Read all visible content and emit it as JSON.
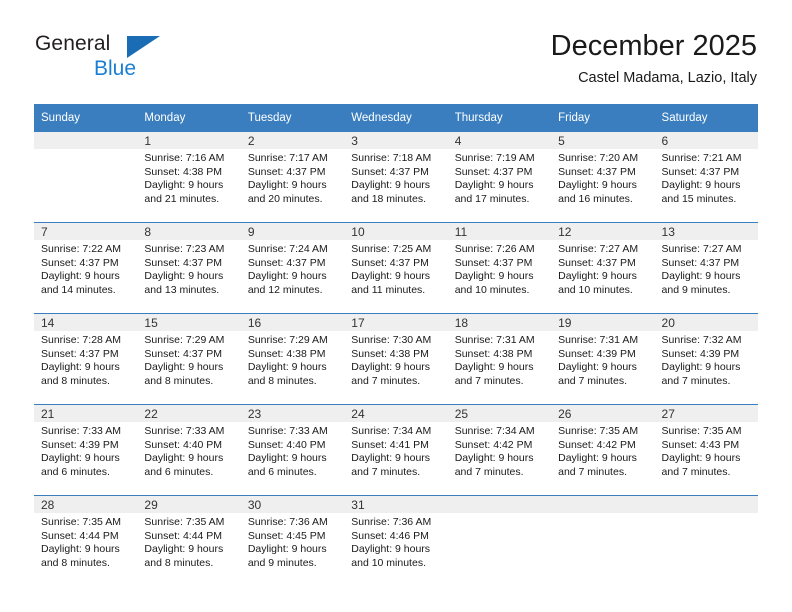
{
  "brand": {
    "name_part1": "General",
    "name_part2": "Blue",
    "triangle_icon": "triangle-icon",
    "color_dark": "#231f20",
    "color_blue": "#1a7fd4"
  },
  "header": {
    "title": "December 2025",
    "subtitle": "Castel Madama, Lazio, Italy"
  },
  "theme": {
    "header_row_bg": "#3a7ebf",
    "daynum_band_bg": "#efefef",
    "grid_line": "#3a7ebf",
    "text": "#1a1a1a"
  },
  "weekday_headers": [
    "Sunday",
    "Monday",
    "Tuesday",
    "Wednesday",
    "Thursday",
    "Friday",
    "Saturday"
  ],
  "weeks": [
    [
      {
        "day": "",
        "lines": []
      },
      {
        "day": "1",
        "lines": [
          "Sunrise: 7:16 AM",
          "Sunset: 4:38 PM",
          "Daylight: 9 hours",
          "and 21 minutes."
        ]
      },
      {
        "day": "2",
        "lines": [
          "Sunrise: 7:17 AM",
          "Sunset: 4:37 PM",
          "Daylight: 9 hours",
          "and 20 minutes."
        ]
      },
      {
        "day": "3",
        "lines": [
          "Sunrise: 7:18 AM",
          "Sunset: 4:37 PM",
          "Daylight: 9 hours",
          "and 18 minutes."
        ]
      },
      {
        "day": "4",
        "lines": [
          "Sunrise: 7:19 AM",
          "Sunset: 4:37 PM",
          "Daylight: 9 hours",
          "and 17 minutes."
        ]
      },
      {
        "day": "5",
        "lines": [
          "Sunrise: 7:20 AM",
          "Sunset: 4:37 PM",
          "Daylight: 9 hours",
          "and 16 minutes."
        ]
      },
      {
        "day": "6",
        "lines": [
          "Sunrise: 7:21 AM",
          "Sunset: 4:37 PM",
          "Daylight: 9 hours",
          "and 15 minutes."
        ]
      }
    ],
    [
      {
        "day": "7",
        "lines": [
          "Sunrise: 7:22 AM",
          "Sunset: 4:37 PM",
          "Daylight: 9 hours",
          "and 14 minutes."
        ]
      },
      {
        "day": "8",
        "lines": [
          "Sunrise: 7:23 AM",
          "Sunset: 4:37 PM",
          "Daylight: 9 hours",
          "and 13 minutes."
        ]
      },
      {
        "day": "9",
        "lines": [
          "Sunrise: 7:24 AM",
          "Sunset: 4:37 PM",
          "Daylight: 9 hours",
          "and 12 minutes."
        ]
      },
      {
        "day": "10",
        "lines": [
          "Sunrise: 7:25 AM",
          "Sunset: 4:37 PM",
          "Daylight: 9 hours",
          "and 11 minutes."
        ]
      },
      {
        "day": "11",
        "lines": [
          "Sunrise: 7:26 AM",
          "Sunset: 4:37 PM",
          "Daylight: 9 hours",
          "and 10 minutes."
        ]
      },
      {
        "day": "12",
        "lines": [
          "Sunrise: 7:27 AM",
          "Sunset: 4:37 PM",
          "Daylight: 9 hours",
          "and 10 minutes."
        ]
      },
      {
        "day": "13",
        "lines": [
          "Sunrise: 7:27 AM",
          "Sunset: 4:37 PM",
          "Daylight: 9 hours",
          "and 9 minutes."
        ]
      }
    ],
    [
      {
        "day": "14",
        "lines": [
          "Sunrise: 7:28 AM",
          "Sunset: 4:37 PM",
          "Daylight: 9 hours",
          "and 8 minutes."
        ]
      },
      {
        "day": "15",
        "lines": [
          "Sunrise: 7:29 AM",
          "Sunset: 4:37 PM",
          "Daylight: 9 hours",
          "and 8 minutes."
        ]
      },
      {
        "day": "16",
        "lines": [
          "Sunrise: 7:29 AM",
          "Sunset: 4:38 PM",
          "Daylight: 9 hours",
          "and 8 minutes."
        ]
      },
      {
        "day": "17",
        "lines": [
          "Sunrise: 7:30 AM",
          "Sunset: 4:38 PM",
          "Daylight: 9 hours",
          "and 7 minutes."
        ]
      },
      {
        "day": "18",
        "lines": [
          "Sunrise: 7:31 AM",
          "Sunset: 4:38 PM",
          "Daylight: 9 hours",
          "and 7 minutes."
        ]
      },
      {
        "day": "19",
        "lines": [
          "Sunrise: 7:31 AM",
          "Sunset: 4:39 PM",
          "Daylight: 9 hours",
          "and 7 minutes."
        ]
      },
      {
        "day": "20",
        "lines": [
          "Sunrise: 7:32 AM",
          "Sunset: 4:39 PM",
          "Daylight: 9 hours",
          "and 7 minutes."
        ]
      }
    ],
    [
      {
        "day": "21",
        "lines": [
          "Sunrise: 7:33 AM",
          "Sunset: 4:39 PM",
          "Daylight: 9 hours",
          "and 6 minutes."
        ]
      },
      {
        "day": "22",
        "lines": [
          "Sunrise: 7:33 AM",
          "Sunset: 4:40 PM",
          "Daylight: 9 hours",
          "and 6 minutes."
        ]
      },
      {
        "day": "23",
        "lines": [
          "Sunrise: 7:33 AM",
          "Sunset: 4:40 PM",
          "Daylight: 9 hours",
          "and 6 minutes."
        ]
      },
      {
        "day": "24",
        "lines": [
          "Sunrise: 7:34 AM",
          "Sunset: 4:41 PM",
          "Daylight: 9 hours",
          "and 7 minutes."
        ]
      },
      {
        "day": "25",
        "lines": [
          "Sunrise: 7:34 AM",
          "Sunset: 4:42 PM",
          "Daylight: 9 hours",
          "and 7 minutes."
        ]
      },
      {
        "day": "26",
        "lines": [
          "Sunrise: 7:35 AM",
          "Sunset: 4:42 PM",
          "Daylight: 9 hours",
          "and 7 minutes."
        ]
      },
      {
        "day": "27",
        "lines": [
          "Sunrise: 7:35 AM",
          "Sunset: 4:43 PM",
          "Daylight: 9 hours",
          "and 7 minutes."
        ]
      }
    ],
    [
      {
        "day": "28",
        "lines": [
          "Sunrise: 7:35 AM",
          "Sunset: 4:44 PM",
          "Daylight: 9 hours",
          "and 8 minutes."
        ]
      },
      {
        "day": "29",
        "lines": [
          "Sunrise: 7:35 AM",
          "Sunset: 4:44 PM",
          "Daylight: 9 hours",
          "and 8 minutes."
        ]
      },
      {
        "day": "30",
        "lines": [
          "Sunrise: 7:36 AM",
          "Sunset: 4:45 PM",
          "Daylight: 9 hours",
          "and 9 minutes."
        ]
      },
      {
        "day": "31",
        "lines": [
          "Sunrise: 7:36 AM",
          "Sunset: 4:46 PM",
          "Daylight: 9 hours",
          "and 10 minutes."
        ]
      },
      {
        "day": "",
        "lines": []
      },
      {
        "day": "",
        "lines": []
      },
      {
        "day": "",
        "lines": []
      }
    ]
  ]
}
